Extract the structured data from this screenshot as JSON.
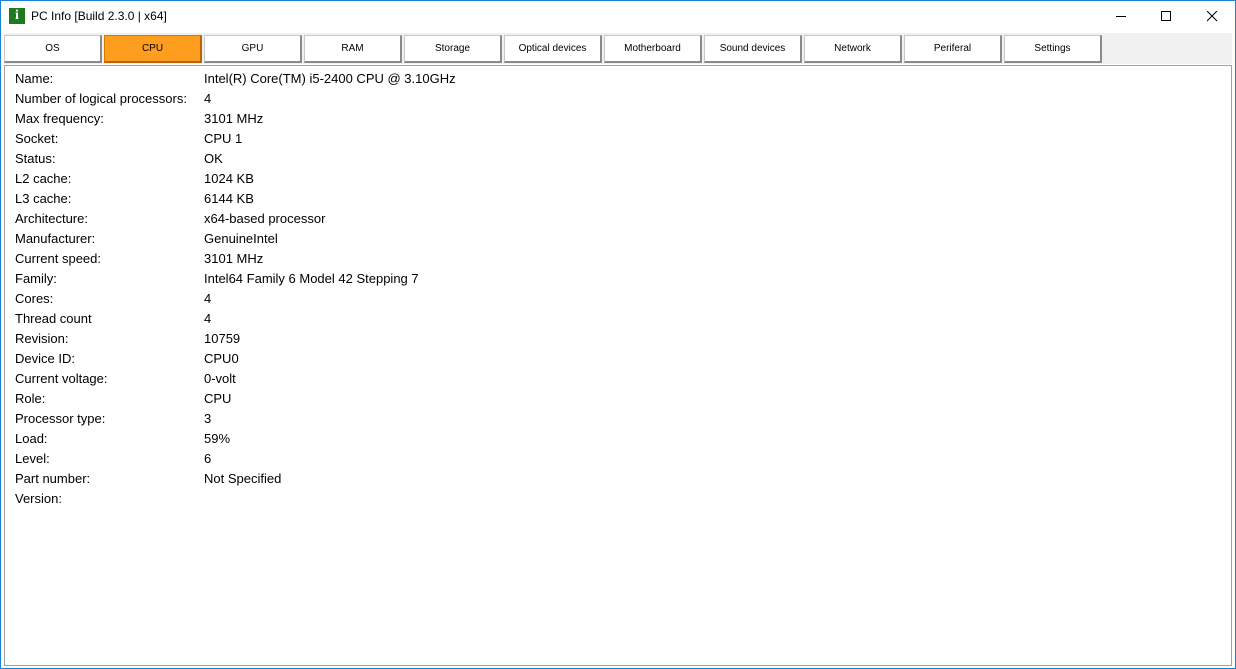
{
  "window": {
    "title": "PC Info [Build 2.3.0 | x64]",
    "app_icon_glyph": "i",
    "icon_name": "app-info-icon",
    "border_color": "#1883d7"
  },
  "controls": {
    "minimize_icon": "minimize-icon",
    "maximize_icon": "maximize-icon",
    "close_icon": "close-icon"
  },
  "tabs": [
    {
      "label": "OS",
      "active": false
    },
    {
      "label": "CPU",
      "active": true
    },
    {
      "label": "GPU",
      "active": false
    },
    {
      "label": "RAM",
      "active": false
    },
    {
      "label": "Storage",
      "active": false
    },
    {
      "label": "Optical devices",
      "active": false
    },
    {
      "label": "Motherboard",
      "active": false
    },
    {
      "label": "Sound devices",
      "active": false
    },
    {
      "label": "Network",
      "active": false
    },
    {
      "label": "Periferal",
      "active": false
    },
    {
      "label": "Settings",
      "active": false
    }
  ],
  "active_tab_color": "#ff9d1f",
  "cpu_info": [
    {
      "label": "Name:",
      "value": "Intel(R) Core(TM) i5-2400 CPU @ 3.10GHz"
    },
    {
      "label": "Number of logical processors:",
      "value": "4"
    },
    {
      "label": "Max frequency:",
      "value": "3101 MHz"
    },
    {
      "label": "Socket:",
      "value": "CPU 1"
    },
    {
      "label": "Status:",
      "value": "OK"
    },
    {
      "label": "L2 cache:",
      "value": "1024 KB"
    },
    {
      "label": "L3 cache:",
      "value": "6144 KB"
    },
    {
      "label": "Architecture:",
      "value": "x64-based processor"
    },
    {
      "label": "Manufacturer:",
      "value": "GenuineIntel"
    },
    {
      "label": "Current speed:",
      "value": "3101 MHz"
    },
    {
      "label": "Family:",
      "value": "Intel64 Family 6 Model 42 Stepping 7"
    },
    {
      "label": "Cores:",
      "value": "4"
    },
    {
      "label": "Thread count",
      "value": "4"
    },
    {
      "label": "Revision:",
      "value": "10759"
    },
    {
      "label": "Device ID:",
      "value": "CPU0"
    },
    {
      "label": "Current voltage:",
      "value": "0-volt"
    },
    {
      "label": "Role:",
      "value": "CPU"
    },
    {
      "label": "Processor type:",
      "value": "3"
    },
    {
      "label": "Load:",
      "value": "59%"
    },
    {
      "label": "Level:",
      "value": "6"
    },
    {
      "label": "Part number:",
      "value": "Not Specified"
    },
    {
      "label": "Version:",
      "value": ""
    }
  ]
}
